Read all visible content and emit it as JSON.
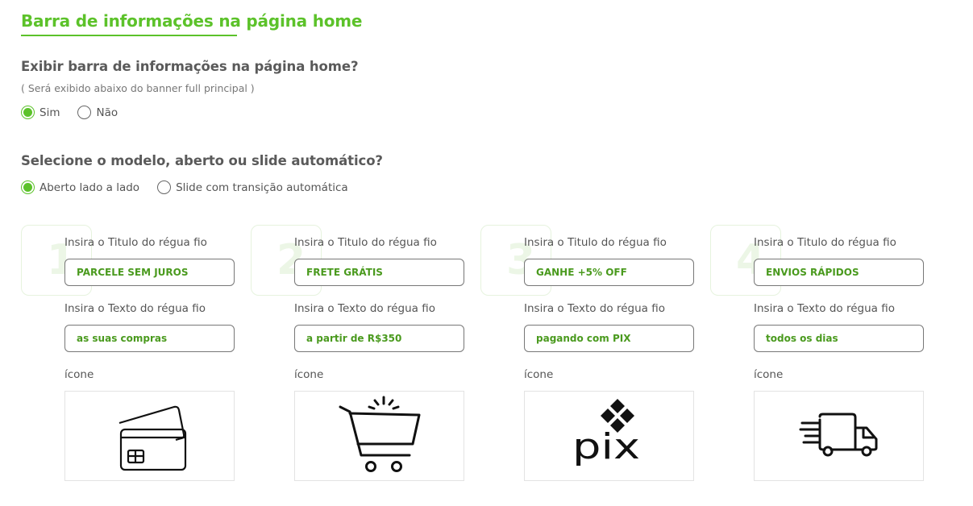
{
  "header": {
    "title": "Barra de informações na página home"
  },
  "show_bar": {
    "question": "Exibir barra de informações na página home?",
    "hint": "( Será exibido abaixo do banner full principal )",
    "options": [
      "Sim",
      "Não"
    ],
    "selected": "Sim"
  },
  "model": {
    "question": "Selecione o modelo, aberto ou slide automático?",
    "options": [
      "Aberto lado a lado",
      "Slide com transição automática"
    ],
    "selected": "Aberto lado a lado"
  },
  "items": [
    {
      "number": "1",
      "title_label": "Insira o Titulo do régua fio",
      "title_value": "PARCELE SEM JUROS",
      "text_label": "Insira o Texto do régua fio",
      "text_value": "as suas compras",
      "icon_label": "ícone",
      "icon": "credit-card-icon"
    },
    {
      "number": "2",
      "title_label": "Insira o Titulo do régua fio",
      "title_value": "FRETE GRÁTIS",
      "text_label": "Insira o Texto do régua fio",
      "text_value": "a partir de R$350",
      "icon_label": "ícone",
      "icon": "shopping-cart-icon"
    },
    {
      "number": "3",
      "title_label": "Insira o Titulo do régua fio",
      "title_value": "GANHE +5% OFF",
      "text_label": "Insira o Texto do régua fio",
      "text_value": "pagando com PIX",
      "icon_label": "ícone",
      "icon": "pix-logo-icon",
      "icon_text": "pix"
    },
    {
      "number": "4",
      "title_label": "Insira o Titulo do régua fio",
      "title_value": "ENVIOS RÁPIDOS",
      "text_label": "Insira o Texto do régua fio",
      "text_value": "todos os dias",
      "icon_label": "ícone",
      "icon": "delivery-truck-icon"
    }
  ],
  "colors": {
    "accent": "#5cc22a",
    "field_text": "#4a9a1e",
    "number_watermark": "#ecf6e6"
  }
}
